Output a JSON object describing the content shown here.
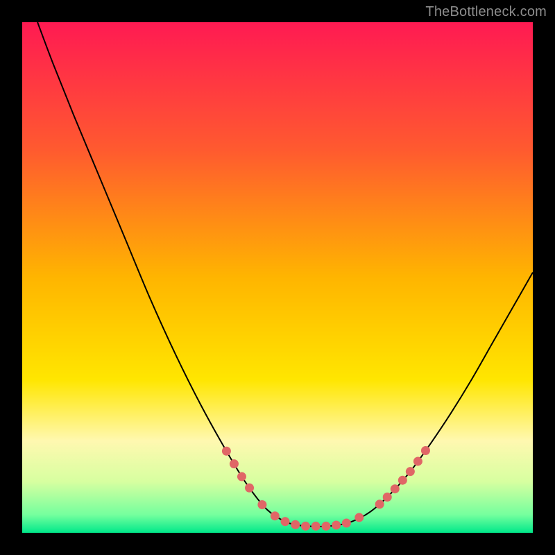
{
  "watermark": "TheBottleneck.com",
  "chart_data": {
    "type": "line",
    "title": "",
    "xlabel": "",
    "ylabel": "",
    "xlim": [
      0,
      100
    ],
    "ylim": [
      0,
      100
    ],
    "gradient_stops": [
      {
        "offset": 0.0,
        "color": "#ff1a52"
      },
      {
        "offset": 0.25,
        "color": "#ff5a2f"
      },
      {
        "offset": 0.5,
        "color": "#ffb500"
      },
      {
        "offset": 0.7,
        "color": "#ffe600"
      },
      {
        "offset": 0.82,
        "color": "#fff8b0"
      },
      {
        "offset": 0.9,
        "color": "#d7ffa0"
      },
      {
        "offset": 0.965,
        "color": "#74ff9e"
      },
      {
        "offset": 1.0,
        "color": "#00e88a"
      }
    ],
    "series": [
      {
        "name": "bottleneck-curve",
        "color": "#000000",
        "points": [
          {
            "x": 3.0,
            "y": 100.0
          },
          {
            "x": 6.0,
            "y": 92.0
          },
          {
            "x": 10.0,
            "y": 82.0
          },
          {
            "x": 15.0,
            "y": 70.0
          },
          {
            "x": 20.0,
            "y": 58.0
          },
          {
            "x": 25.0,
            "y": 46.0
          },
          {
            "x": 30.0,
            "y": 35.0
          },
          {
            "x": 35.0,
            "y": 25.0
          },
          {
            "x": 40.0,
            "y": 16.0
          },
          {
            "x": 44.0,
            "y": 9.5
          },
          {
            "x": 48.0,
            "y": 4.5
          },
          {
            "x": 52.0,
            "y": 2.0
          },
          {
            "x": 56.0,
            "y": 1.3
          },
          {
            "x": 60.0,
            "y": 1.3
          },
          {
            "x": 64.0,
            "y": 2.0
          },
          {
            "x": 68.0,
            "y": 4.0
          },
          {
            "x": 72.0,
            "y": 7.5
          },
          {
            "x": 76.0,
            "y": 12.0
          },
          {
            "x": 80.0,
            "y": 17.5
          },
          {
            "x": 84.0,
            "y": 23.5
          },
          {
            "x": 88.0,
            "y": 30.0
          },
          {
            "x": 92.0,
            "y": 37.0
          },
          {
            "x": 96.0,
            "y": 44.0
          },
          {
            "x": 100.0,
            "y": 51.0
          }
        ]
      }
    ],
    "markers": {
      "name": "highlight-dots",
      "color": "#e06666",
      "radius": 6.5,
      "points": [
        {
          "x": 40.0,
          "y": 16.0
        },
        {
          "x": 41.5,
          "y": 13.5
        },
        {
          "x": 43.0,
          "y": 11.0
        },
        {
          "x": 44.5,
          "y": 8.8
        },
        {
          "x": 47.0,
          "y": 5.5
        },
        {
          "x": 49.5,
          "y": 3.3
        },
        {
          "x": 51.5,
          "y": 2.2
        },
        {
          "x": 53.5,
          "y": 1.6
        },
        {
          "x": 55.5,
          "y": 1.3
        },
        {
          "x": 57.5,
          "y": 1.3
        },
        {
          "x": 59.5,
          "y": 1.3
        },
        {
          "x": 61.5,
          "y": 1.5
        },
        {
          "x": 63.5,
          "y": 1.9
        },
        {
          "x": 66.0,
          "y": 3.0
        },
        {
          "x": 70.0,
          "y": 5.6
        },
        {
          "x": 71.5,
          "y": 7.0
        },
        {
          "x": 73.0,
          "y": 8.6
        },
        {
          "x": 74.5,
          "y": 10.3
        },
        {
          "x": 76.0,
          "y": 12.0
        },
        {
          "x": 77.5,
          "y": 14.0
        },
        {
          "x": 79.0,
          "y": 16.1
        }
      ]
    }
  }
}
